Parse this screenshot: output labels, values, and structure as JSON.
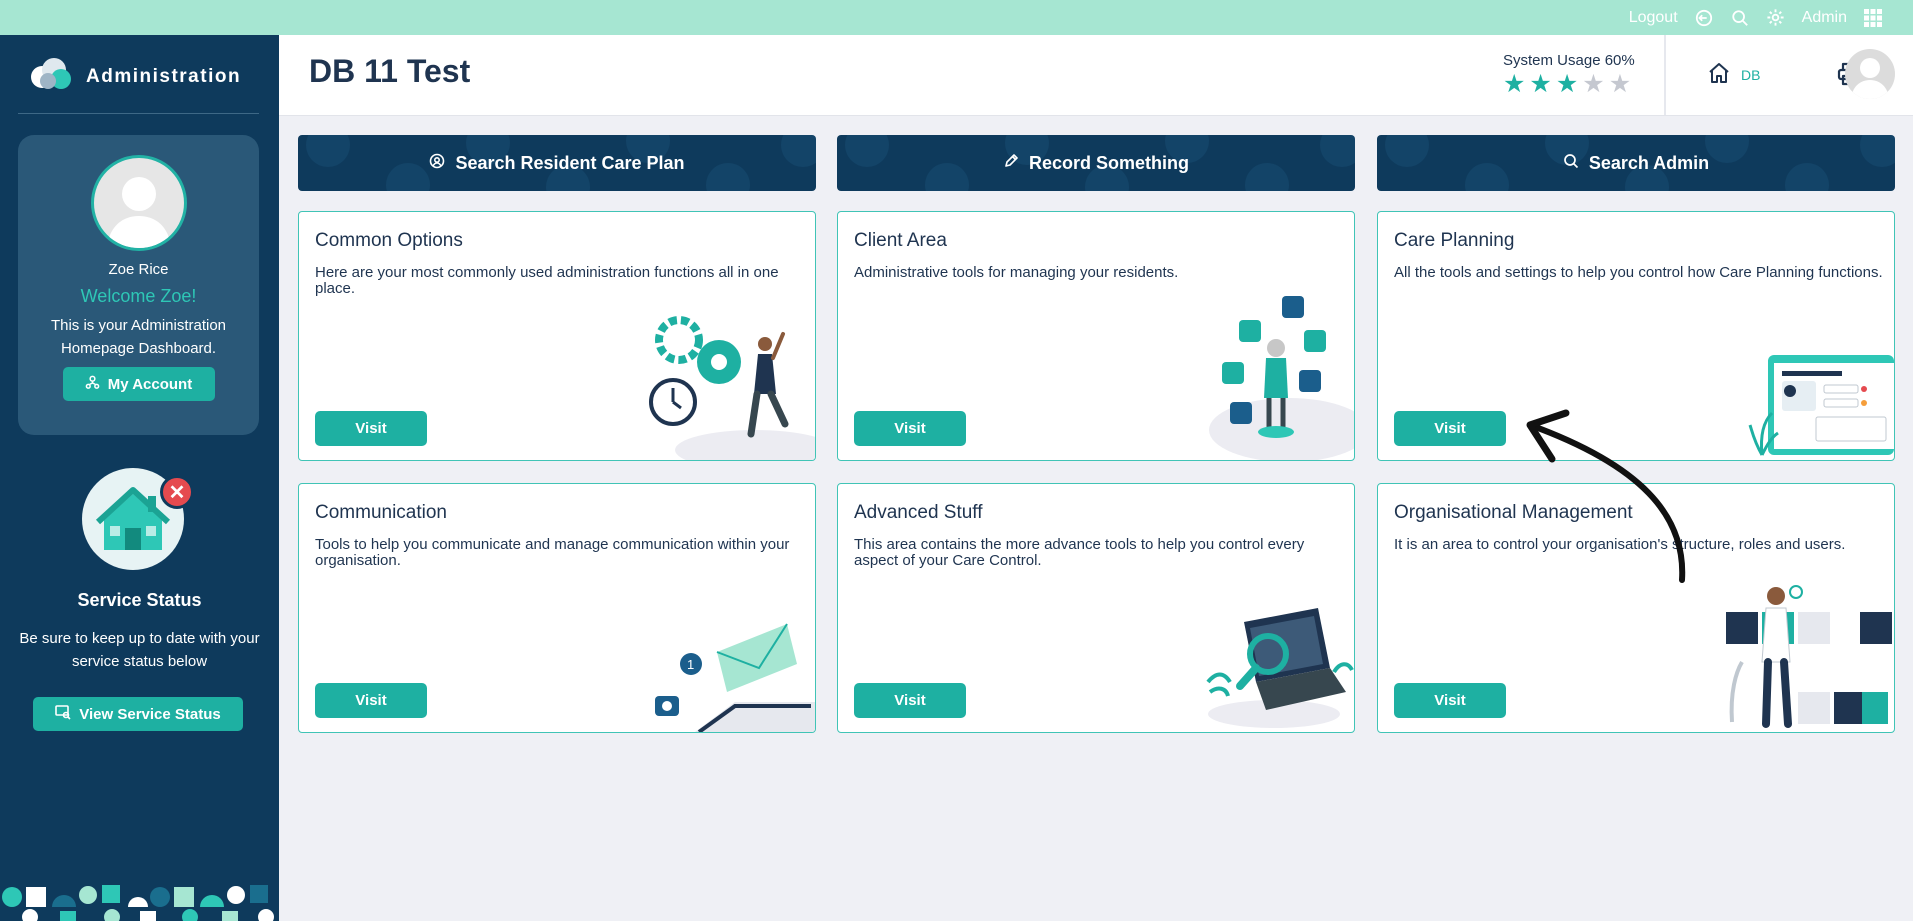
{
  "topbar": {
    "logout_label": "Logout",
    "user_label": "Admin"
  },
  "sidebar": {
    "brand": "Administration",
    "profile": {
      "name": "Zoe Rice",
      "welcome": "Welcome Zoe!",
      "description": "This is your Administration Homepage Dashboard.",
      "account_button": "My Account"
    },
    "service": {
      "title": "Service Status",
      "description": "Be sure to keep up to date with your service status below",
      "button": "View Service Status"
    }
  },
  "header": {
    "title": "DB 11 Test",
    "usage_label": "System Usage 60%",
    "usage_stars": 3,
    "usage_stars_total": 5,
    "home_label": "DB"
  },
  "banners": [
    {
      "label": "Search Resident Care Plan",
      "icon": "user-circle-icon"
    },
    {
      "label": "Record Something",
      "icon": "pencil-icon"
    },
    {
      "label": "Search Admin",
      "icon": "search-icon"
    }
  ],
  "cards": [
    {
      "title": "Common Options",
      "description": "Here are your most commonly used administration functions all in one place.",
      "button": "Visit"
    },
    {
      "title": "Client Area",
      "description": "Administrative tools for managing your residents.",
      "button": "Visit"
    },
    {
      "title": "Care Planning",
      "description": "All the tools and settings to help you control how Care Planning functions.",
      "button": "Visit"
    },
    {
      "title": "Communication",
      "description": "Tools to help you communicate and manage communication within your organisation.",
      "button": "Visit"
    },
    {
      "title": "Advanced Stuff",
      "description": "This area contains the more advance tools to help you control every aspect of your Care Control.",
      "button": "Visit"
    },
    {
      "title": "Organisational Management",
      "description": "It is an area to control your organisation's structure, roles and users.",
      "button": "Visit"
    }
  ],
  "colors": {
    "accent": "#1eb0a2",
    "navy": "#0e3a5c",
    "topbar": "#a6e6d2",
    "star_on": "#1eb0a2",
    "star_off": "#c5c8d0"
  }
}
